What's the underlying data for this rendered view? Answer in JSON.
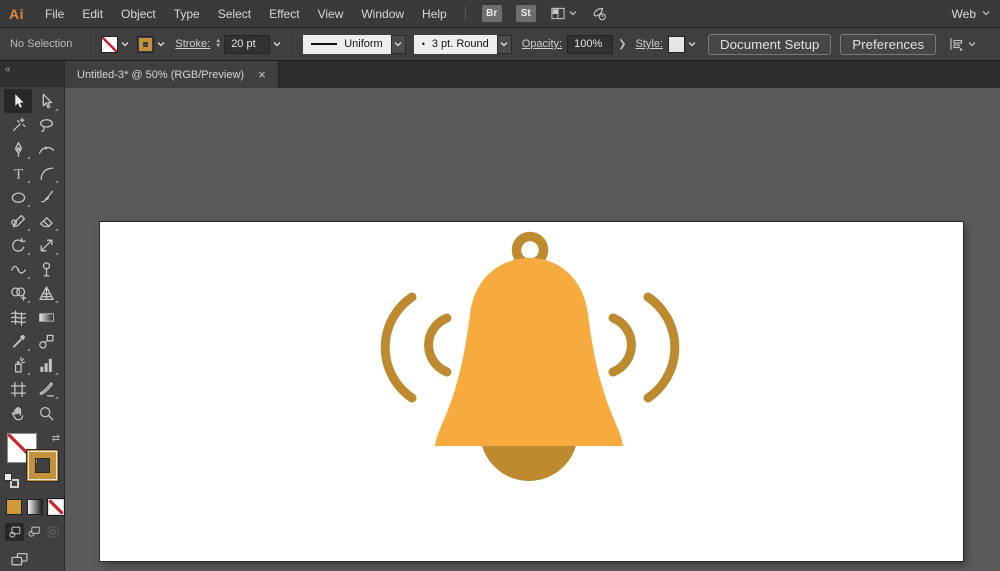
{
  "menubar": {
    "logo": "Ai",
    "menus": [
      "File",
      "Edit",
      "Object",
      "Type",
      "Select",
      "Effect",
      "View",
      "Window",
      "Help"
    ],
    "bridge_label": "Br",
    "stock_label": "St",
    "workspace": "Web"
  },
  "controlbar": {
    "selection_status": "No Selection",
    "stroke_label": "Stroke:",
    "stroke_value": "20 pt",
    "width_profile": "Uniform",
    "brush_dot": "•",
    "brush": "3 pt. Round",
    "opacity_label": "Opacity:",
    "opacity_value": "100%",
    "opacity_more_glyph": "❯",
    "style_label": "Style:",
    "document_setup_label": "Document Setup",
    "preferences_label": "Preferences"
  },
  "document_tab": {
    "title": "Untitled-3* @ 50% (RGB/Preview)",
    "close_glyph": "×"
  },
  "toolbar": {
    "collapse_glyph": "«",
    "swap_glyph": "⇄",
    "tools": [
      {
        "name": "selection",
        "selected": true
      },
      {
        "name": "direct-selection",
        "flyout": true
      },
      {
        "name": "magic-wand"
      },
      {
        "name": "lasso"
      },
      {
        "name": "pen",
        "flyout": true
      },
      {
        "name": "curvature"
      },
      {
        "name": "type",
        "flyout": true
      },
      {
        "name": "arc",
        "flyout": true
      },
      {
        "name": "ellipse",
        "flyout": true
      },
      {
        "name": "paintbrush"
      },
      {
        "name": "shaper",
        "flyout": true
      },
      {
        "name": "eraser",
        "flyout": true
      },
      {
        "name": "rotate",
        "flyout": true
      },
      {
        "name": "scale",
        "flyout": true
      },
      {
        "name": "width",
        "flyout": true
      },
      {
        "name": "puppet-warp"
      },
      {
        "name": "shape-builder",
        "flyout": true
      },
      {
        "name": "perspective-grid",
        "flyout": true
      },
      {
        "name": "mesh"
      },
      {
        "name": "gradient"
      },
      {
        "name": "eyedropper",
        "flyout": true
      },
      {
        "name": "blend"
      },
      {
        "name": "symbol-sprayer",
        "flyout": true
      },
      {
        "name": "column-graph",
        "flyout": true
      },
      {
        "name": "artboard"
      },
      {
        "name": "slice",
        "flyout": true
      },
      {
        "name": "hand"
      },
      {
        "name": "zoom"
      }
    ],
    "fill_paint": "none",
    "stroke_paint": "#C3913C",
    "active_paint_button": "none",
    "active_drawing_mode": "draw-normal"
  },
  "colors": {
    "bell_body": "#F7AA3D",
    "bell_dark": "#BE8A2F",
    "stroke_swatch_gold": "#C3913C",
    "none_red": "#D2232A",
    "canvas_bg": "#5B5B5B",
    "artboard_bg": "#FFFFFF",
    "logo_orange": "#E0883A"
  }
}
